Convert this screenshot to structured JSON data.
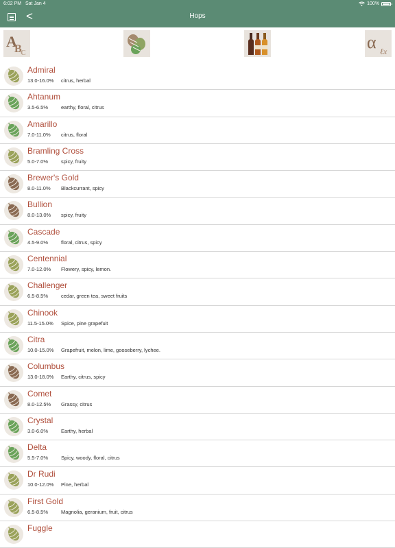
{
  "status_bar": {
    "time": "6:02 PM",
    "date": "Sat Jan 4",
    "battery": "100%"
  },
  "header": {
    "title": "Hops",
    "back_label": "<"
  },
  "toolbar": {
    "buttons": [
      {
        "name": "sort-alphabetical-button",
        "icon": "abc-letters-icon"
      },
      {
        "name": "hop-view-button",
        "icon": "hop-cones-icon"
      },
      {
        "name": "beer-style-button",
        "icon": "beer-bottles-icon"
      },
      {
        "name": "alpha-acid-sort-button",
        "icon": "alpha-symbol-icon"
      }
    ]
  },
  "colors": {
    "header": "#5b8b74",
    "hop_name": "#b04f3c",
    "hop_green": "#6aa35a",
    "hop_olive": "#9aa25a",
    "hop_brown": "#8a6a52"
  },
  "hops": [
    {
      "name": "Admiral",
      "alpha": "13.0-16.0%",
      "flavor": "citrus, herbal",
      "tone": "olive"
    },
    {
      "name": "Ahtanum",
      "alpha": "3.5-6.5%",
      "flavor": "earthy, floral, citrus",
      "tone": "green"
    },
    {
      "name": "Amarillo",
      "alpha": "7.0-11.0%",
      "flavor": "citrus, floral",
      "tone": "green"
    },
    {
      "name": "Bramling Cross",
      "alpha": "5.0-7.0%",
      "flavor": "spicy, fruity",
      "tone": "olive"
    },
    {
      "name": "Brewer's Gold",
      "alpha": "8.0-11.0%",
      "flavor": "Blackcurrant, spicy",
      "tone": "brown"
    },
    {
      "name": "Bullion",
      "alpha": "8.0-13.0%",
      "flavor": "spicy, fruity",
      "tone": "brown"
    },
    {
      "name": "Cascade",
      "alpha": "4.5-9.0%",
      "flavor": "floral, citrus, spicy",
      "tone": "green"
    },
    {
      "name": "Centennial",
      "alpha": "7.0-12.0%",
      "flavor": "Flowery, spicy, lemon.",
      "tone": "olive"
    },
    {
      "name": "Challenger",
      "alpha": "6.5-8.5%",
      "flavor": "cedar, green tea, sweet fruits",
      "tone": "olive"
    },
    {
      "name": "Chinook",
      "alpha": "11.5-15.0%",
      "flavor": "Spice, pine grapefuit",
      "tone": "olive"
    },
    {
      "name": "Citra",
      "alpha": "10.0-15.0%",
      "flavor": "Grapefruit, melon, lime, gooseberry, lychee.",
      "tone": "green"
    },
    {
      "name": "Columbus",
      "alpha": "13.0-18.0%",
      "flavor": "Earthy, citrus, spicy",
      "tone": "brown"
    },
    {
      "name": "Comet",
      "alpha": "8.0-12.5%",
      "flavor": "Grassy, citrus",
      "tone": "brown"
    },
    {
      "name": "Crystal",
      "alpha": "3.0-6.0%",
      "flavor": "Earthy, herbal",
      "tone": "green"
    },
    {
      "name": "Delta",
      "alpha": "5.5-7.0%",
      "flavor": "Spicy, woody, floral, citrus",
      "tone": "green"
    },
    {
      "name": "Dr Rudi",
      "alpha": "10.0-12.0%",
      "flavor": "Pine, herbal",
      "tone": "olive"
    },
    {
      "name": "First Gold",
      "alpha": "6.5-8.5%",
      "flavor": "Magnolia, geranium, fruit, citrus",
      "tone": "olive"
    },
    {
      "name": "Fuggle",
      "alpha": "",
      "flavor": "",
      "tone": "olive"
    }
  ]
}
